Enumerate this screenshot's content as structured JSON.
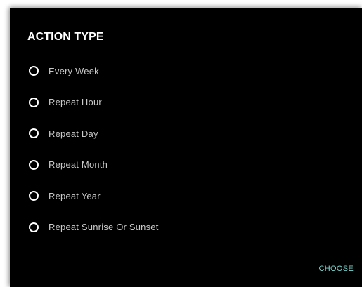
{
  "dialog": {
    "title": "ACTION TYPE",
    "options": [
      {
        "label": "Every Week",
        "selected": false
      },
      {
        "label": "Repeat Hour",
        "selected": false
      },
      {
        "label": "Repeat Day",
        "selected": false
      },
      {
        "label": "Repeat Month",
        "selected": false
      },
      {
        "label": "Repeat Year",
        "selected": false
      },
      {
        "label": "Repeat Sunrise Or Sunset",
        "selected": false
      }
    ],
    "choose_label": "CHOOSE"
  },
  "colors": {
    "background": "#000000",
    "text": "#c9c9c9",
    "title": "#ffffff",
    "accent": "#7fd4cf"
  }
}
